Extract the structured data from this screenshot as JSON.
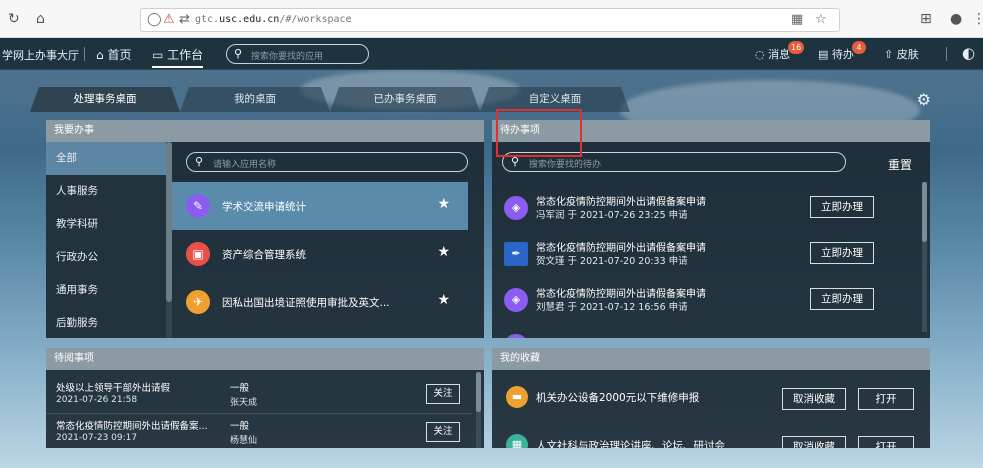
{
  "browser": {
    "url_prefix": "gtc.",
    "url_domain": "usc.edu.cn",
    "url_path": "/#/workspace"
  },
  "header": {
    "app_title": "学网上办事大厅",
    "nav_home": "首页",
    "nav_workbench": "工作台",
    "search_placeholder": "搜索你要找的应用",
    "messages_label": "消息",
    "messages_count": "16",
    "todo_label": "待办",
    "todo_count": "4",
    "skin_label": "皮肤"
  },
  "tabs": [
    {
      "label": "处理事务桌面"
    },
    {
      "label": "我的桌面"
    },
    {
      "label": "已办事务桌面"
    },
    {
      "label": "自定义桌面"
    }
  ],
  "my_tasks": {
    "title": "我要办事",
    "categories": [
      {
        "label": "全部"
      },
      {
        "label": "人事服务"
      },
      {
        "label": "教学科研"
      },
      {
        "label": "行政办公"
      },
      {
        "label": "通用事务"
      },
      {
        "label": "后勤服务"
      }
    ],
    "search_placeholder": "请输入应用名称",
    "apps": [
      {
        "name": "学术交流申请统计",
        "icon": "feather-icon",
        "color": "#8a5cf0"
      },
      {
        "name": "资产综合管理系统",
        "icon": "box-icon",
        "color": "#e8514a"
      },
      {
        "name": "因私出国出境证照使用审批及英文...",
        "icon": "plane-icon",
        "color": "#f0a030"
      }
    ]
  },
  "todo": {
    "title": "待办事项",
    "search_placeholder": "搜索你要找的待办",
    "reset_label": "重置",
    "action_label": "立即办理",
    "items": [
      {
        "title": "常态化疫情防控期间外出请假备案申请",
        "sub": "冯军润 于 2021-07-26 23:25 申请",
        "icon": "cube-icon",
        "color": "#8a5cf0"
      },
      {
        "title": "常态化疫情防控期间外出请假备案申请",
        "sub": "贺文瑾 于 2021-07-20 20:33 申请",
        "icon": "pen-icon",
        "color": "#2a66c8"
      },
      {
        "title": "常态化疫情防控期间外出请假备案申请",
        "sub": "刘慧君 于 2021-07-12 16:56 申请",
        "icon": "cube-icon",
        "color": "#8a5cf0"
      }
    ]
  },
  "pending": {
    "title": "待阅事项",
    "action_label": "关注",
    "items": [
      {
        "title": "处级以上领导干部外出请假",
        "date": "2021-07-26 21:58",
        "level": "一般",
        "person": "张天成"
      },
      {
        "title": "常态化疫情防控期间外出请假备案...",
        "date": "2021-07-23 09:17",
        "level": "一般",
        "person": "杨慧仙"
      }
    ]
  },
  "favorites": {
    "title": "我的收藏",
    "cancel_label": "取消收藏",
    "open_label": "打开",
    "items": [
      {
        "name": "机关办公设备2000元以下维修申报",
        "icon": "doc-icon",
        "color": "#f0a030"
      },
      {
        "name": "人文社科与政治理论讲座、论坛、研讨会",
        "icon": "grid-icon",
        "color": "#3ab39a"
      }
    ]
  }
}
